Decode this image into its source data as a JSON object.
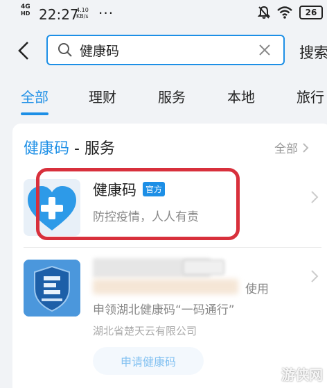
{
  "status_bar": {
    "network": "4G",
    "network_sub": "HD",
    "time": "22:27",
    "speed_value": "4.10",
    "speed_unit": "KB/s",
    "dots": "···",
    "battery": "26"
  },
  "search": {
    "query": "健康码",
    "button_label": "搜索"
  },
  "tabs": [
    {
      "label": "全部",
      "active": true
    },
    {
      "label": "理财"
    },
    {
      "label": "服务"
    },
    {
      "label": "本地"
    },
    {
      "label": "旅行"
    }
  ],
  "section": {
    "title_highlight": "健康码",
    "title_rest": " - 服务",
    "all_label": "全部"
  },
  "results": [
    {
      "name": "健康码",
      "badge": "官方",
      "description": "防控疫情，人人有责"
    },
    {
      "name_blurred": "湖北健康码",
      "badge_blurred": "使用过",
      "line_blurred_tail": "使用",
      "description": "申领湖北健康码“一码通行”",
      "provider": "湖北省楚天云有限公司",
      "button_label": "申请健康码"
    }
  ],
  "watermark": "游侠网",
  "colors": {
    "accent": "#1d8fe6",
    "highlight_ring": "#d8303c"
  }
}
